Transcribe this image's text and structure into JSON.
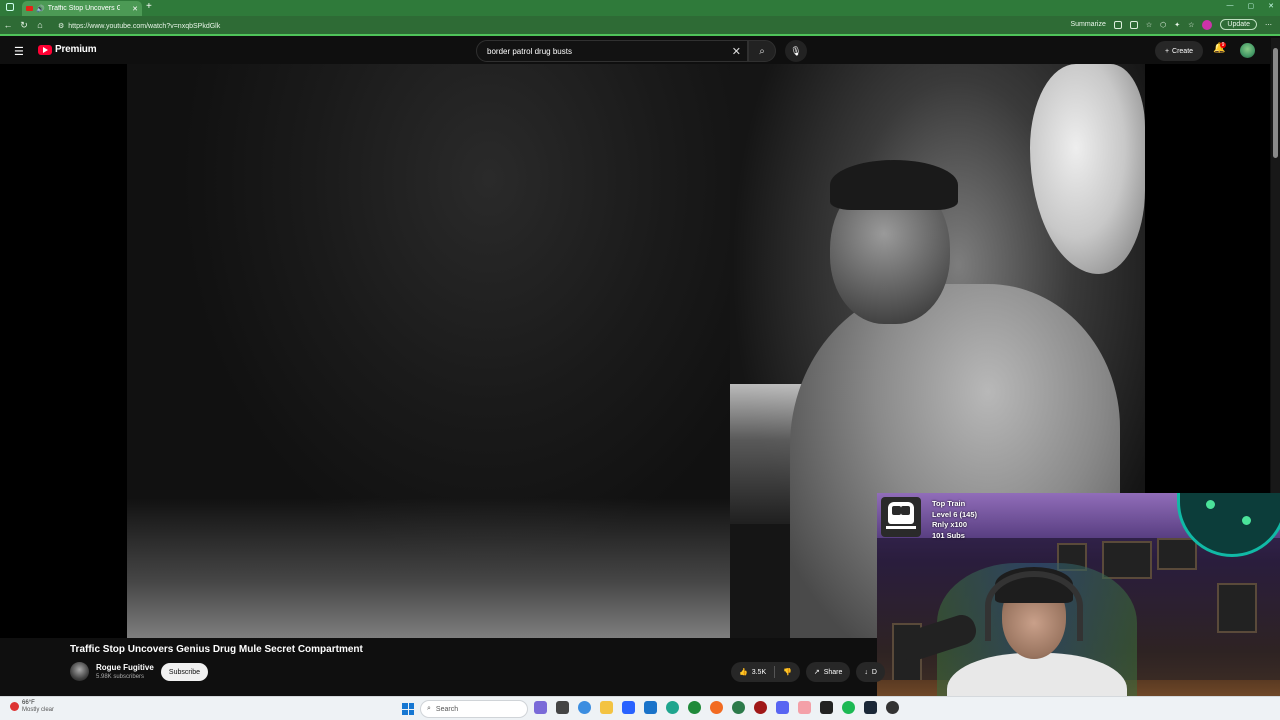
{
  "browser": {
    "tab_title": "Traffic Stop Uncovers Genius",
    "url": "https://www.youtube.com/watch?v=nxqbSPkdGlk",
    "summarize_label": "Summarize",
    "update_label": "Update"
  },
  "youtube": {
    "logo_text": "Premium",
    "search_query": "border patrol drug busts",
    "create_label": "Create",
    "notification_count": "9"
  },
  "overlay": {
    "line1": "Top Train",
    "line2": "Level 6  (145)",
    "line3": "Rnly x100",
    "line4": "101 Subs"
  },
  "video": {
    "title": "Traffic Stop Uncovers Genius Drug Mule Secret Compartment",
    "channel": "Rogue Fugitive",
    "subscribers": "5.98K subscribers",
    "subscribe_label": "Subscribe",
    "likes": "3.5K",
    "share_label": "Share",
    "download_label": "D"
  },
  "taskbar": {
    "temperature": "66°F",
    "weather": "Mostly clear",
    "search_label": "Search"
  },
  "colors": {
    "browser_green": "#2f7a3a",
    "yt_red": "#ff0033"
  }
}
